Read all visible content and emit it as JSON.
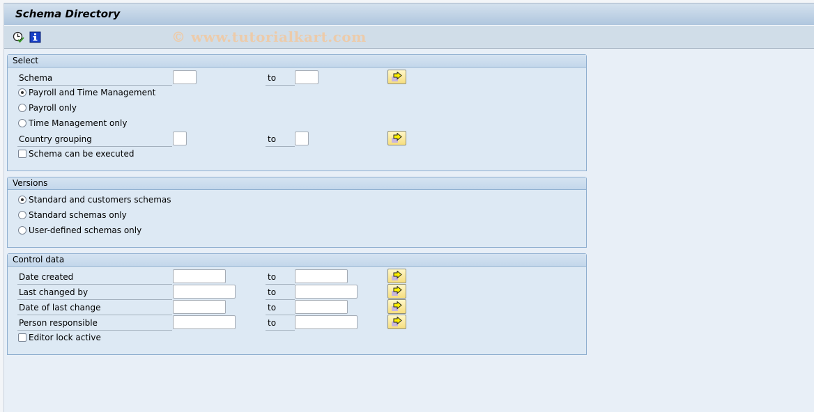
{
  "window": {
    "title": "Schema Directory"
  },
  "toolbar": {
    "icons": [
      {
        "name": "execute-clock-icon",
        "tooltip": "Execute"
      },
      {
        "name": "information-icon",
        "tooltip": "Information"
      }
    ],
    "watermark": "© www.tutorialkart.com"
  },
  "select": {
    "header": "Select",
    "schema": {
      "label": "Schema",
      "from": "",
      "to_label": "to",
      "to": ""
    },
    "radios": [
      {
        "label": "Payroll and Time Management",
        "checked": true
      },
      {
        "label": "Payroll only",
        "checked": false
      },
      {
        "label": "Time Management only",
        "checked": false
      }
    ],
    "country": {
      "label": "Country grouping",
      "from": "",
      "to_label": "to",
      "to": ""
    },
    "executable": {
      "label": "Schema can be executed",
      "checked": false
    }
  },
  "versions": {
    "header": "Versions",
    "radios": [
      {
        "label": "Standard and customers schemas",
        "checked": true
      },
      {
        "label": "Standard schemas only",
        "checked": false
      },
      {
        "label": "User-defined schemas only",
        "checked": false
      }
    ]
  },
  "control": {
    "header": "Control data",
    "rows": [
      {
        "label": "Date created",
        "from": "",
        "to_label": "to",
        "to": ""
      },
      {
        "label": "Last changed by",
        "from": "",
        "to_label": "to",
        "to": ""
      },
      {
        "label": "Date of last change",
        "from": "",
        "to_label": "to",
        "to": ""
      },
      {
        "label": "Person responsible",
        "from": "",
        "to_label": "to",
        "to": ""
      }
    ],
    "editor_lock": {
      "label": "Editor lock active",
      "checked": false
    }
  },
  "colors": {
    "title_bar": "#afc6de",
    "toolbar": "#d0dde8",
    "group_bg": "#dde9f4",
    "group_border": "#8eaecf",
    "multi_button": "#f6de7e",
    "watermark": "#f2c9a0"
  }
}
